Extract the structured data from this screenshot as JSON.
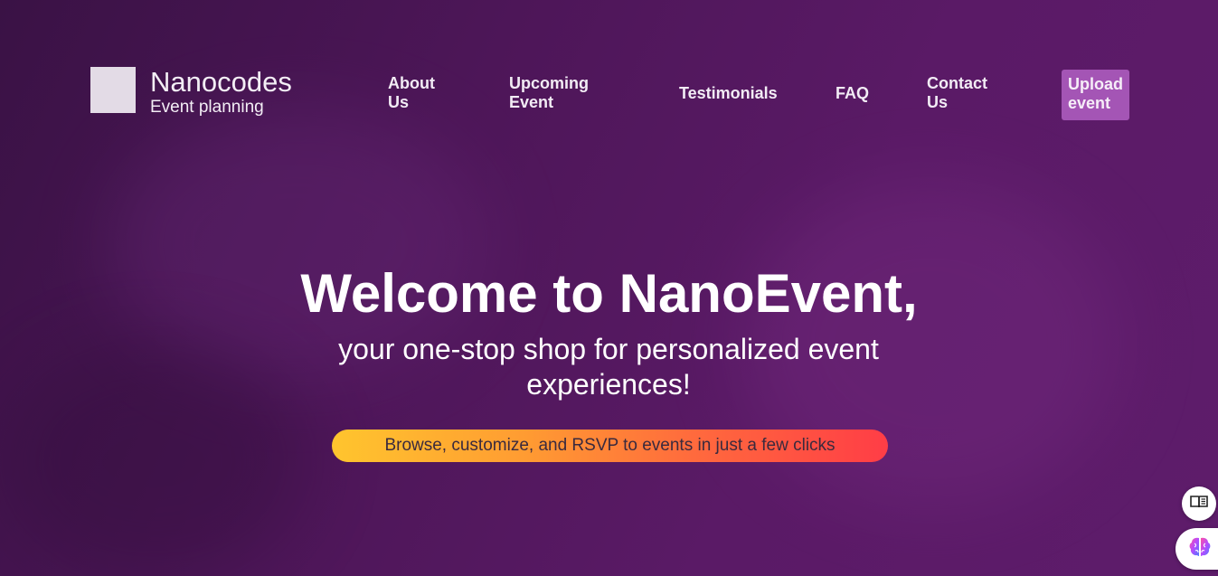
{
  "brand": {
    "name": "Nanocodes",
    "tagline": "Event planning"
  },
  "nav": {
    "about": "About Us",
    "upcoming": "Upcoming Event",
    "testimonials": "Testimonials",
    "faq": "FAQ",
    "contact": "Contact Us",
    "upload": "Upload event"
  },
  "hero": {
    "title": "Welcome to NanoEvent,",
    "subtitle": "your one-stop shop for personalized event experiences!",
    "pill": "Browse, customize, and RSVP to events in just a few clicks"
  },
  "widgets": {
    "reader_icon": "book-reader-icon",
    "assistant_icon": "brain-icon"
  },
  "colors": {
    "background": "#4d1658",
    "upload_button": "#a455b5",
    "pill_gradient_start": "#ffc52e",
    "pill_gradient_end": "#ff3d46"
  }
}
